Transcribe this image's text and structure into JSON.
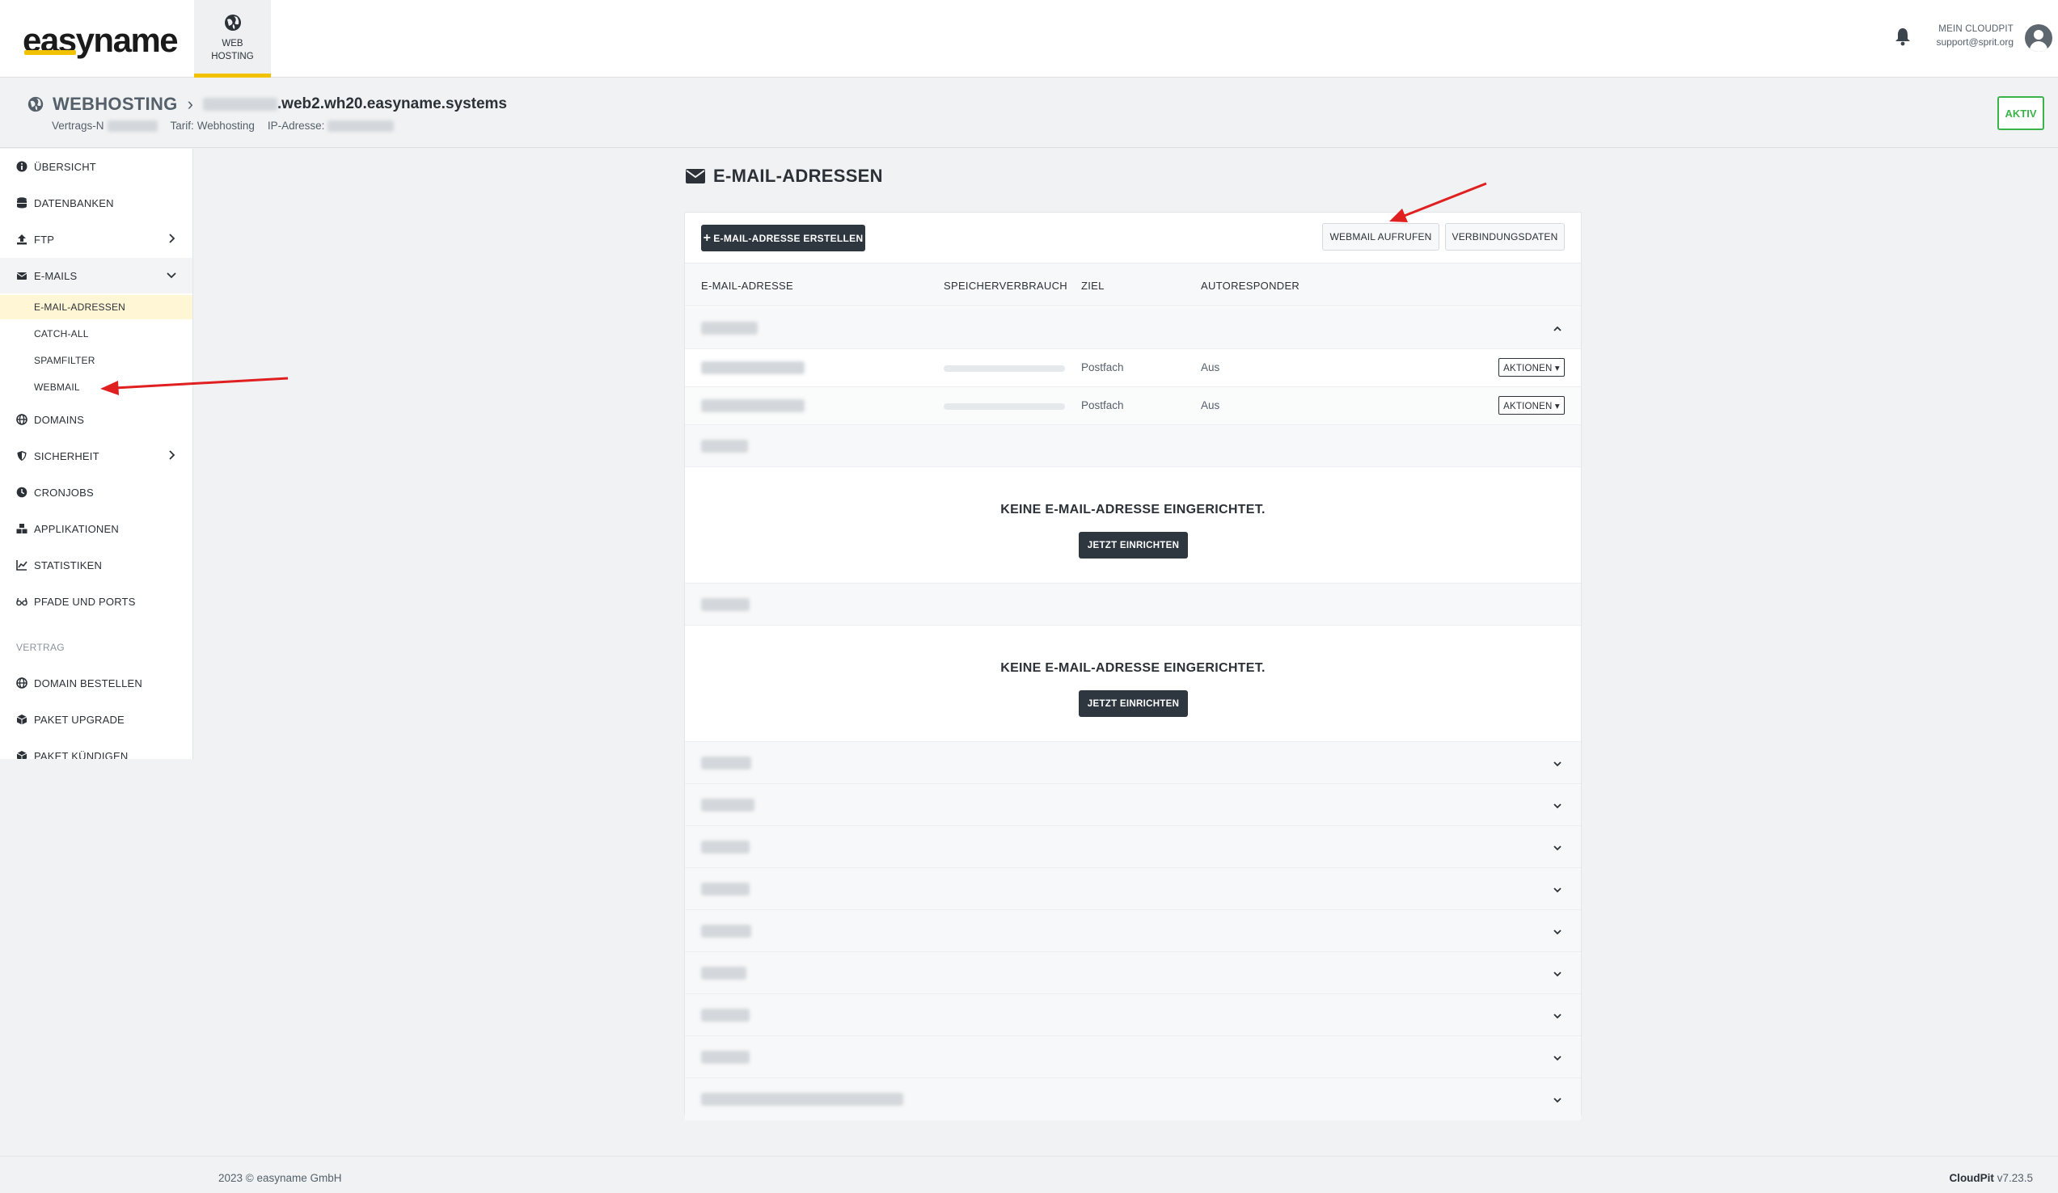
{
  "topbar": {
    "logo": "easyname",
    "tab_webhosting": "WEB\nHOSTING",
    "account_title": "MEIN CLOUDPIT",
    "account_email": "support@sprit.org"
  },
  "header": {
    "section": "WEBHOSTING",
    "host_suffix": ".web2.wh20.easyname.systems",
    "contract_label": "Vertrags-N",
    "tariff_label": "Tarif:",
    "tariff_value": "Webhosting",
    "ip_label": "IP-Adresse:",
    "status": "AKTIV"
  },
  "sidebar": {
    "items": [
      {
        "label": "ÜBERSICHT",
        "icon": "info-icon"
      },
      {
        "label": "DATENBANKEN",
        "icon": "database-icon"
      },
      {
        "label": "FTP",
        "icon": "upload-icon"
      },
      {
        "label": "E-MAILS",
        "icon": "envelope-icon"
      }
    ],
    "email_sub": [
      "E-MAIL-ADRESSEN",
      "CATCH-ALL",
      "SPAMFILTER",
      "WEBMAIL"
    ],
    "items2": [
      {
        "label": "DOMAINS",
        "icon": "globe-icon"
      },
      {
        "label": "SICHERHEIT",
        "icon": "shield-icon"
      },
      {
        "label": "CRONJOBS",
        "icon": "clock-icon"
      },
      {
        "label": "APPLIKATIONEN",
        "icon": "boxes-icon"
      },
      {
        "label": "STATISTIKEN",
        "icon": "chart-icon"
      },
      {
        "label": "PFADE UND PORTS",
        "icon": "glasses-icon"
      }
    ],
    "section_vertrag": "VERTRAG",
    "items3": [
      {
        "label": "DOMAIN BESTELLEN",
        "icon": "globe-icon"
      },
      {
        "label": "PAKET UPGRADE",
        "icon": "package-icon"
      },
      {
        "label": "PAKET KÜNDIGEN",
        "icon": "package-icon"
      }
    ]
  },
  "main": {
    "title": "E-MAIL-ADRESSEN",
    "create_button": "E-MAIL-ADRESSE ERSTELLEN",
    "webmail_button": "WEBMAIL AUFRUFEN",
    "connection_button": "VERBINDUNGSDATEN",
    "columns": [
      "E-MAIL-ADRESSE",
      "SPEICHERVERBRAUCH",
      "ZIEL",
      "AUTORESPONDER"
    ],
    "rows": [
      {
        "target": "Postfach",
        "autoresponder": "Aus",
        "action": "AKTIONEN ▾"
      },
      {
        "target": "Postfach",
        "autoresponder": "Aus",
        "action": "AKTIONEN ▾"
      }
    ],
    "empty_message": "KEINE E-MAIL-ADRESSE EINGERICHTET.",
    "setup_button": "JETZT EINRICHTEN"
  },
  "footer": {
    "copyright": "2023 © easyname GmbH",
    "brand": "CloudPit",
    "version": "v7.23.5"
  },
  "colors": {
    "accent": "#f2c200",
    "dark_button": "#2e3640",
    "status_green": "#3bb34a",
    "annotation_red": "#e02020"
  }
}
